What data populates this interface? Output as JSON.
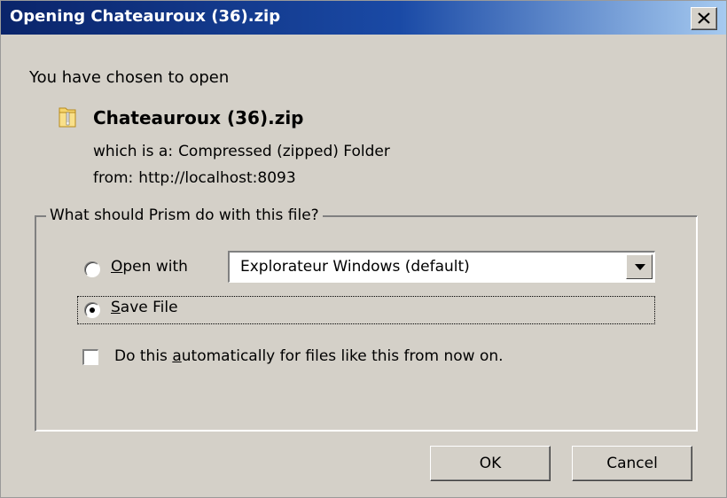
{
  "window": {
    "title": "Opening Chateauroux (36).zip",
    "close_icon": "close-x-icon"
  },
  "info": {
    "intro": "You have chosen to open",
    "file_icon": "zip-folder-icon",
    "file_name": "Chateauroux (36).zip",
    "type_label": "which is a:",
    "type_value": "Compressed (zipped) Folder",
    "from_label": "from:",
    "from_value": "http://localhost:8093"
  },
  "action_group": {
    "legend": "What should Prism do with this file?",
    "open_with": {
      "label_accel": "O",
      "label_rest": "pen with",
      "selected": false,
      "app_value": "Explorateur Windows (default)"
    },
    "save_file": {
      "label_accel": "S",
      "label_rest": "ave File",
      "selected": true
    },
    "auto": {
      "label_before": "Do this ",
      "label_accel": "a",
      "label_after": "utomatically for files like this from now on.",
      "checked": false
    }
  },
  "buttons": {
    "ok": "OK",
    "cancel": "Cancel"
  },
  "colors": {
    "titlebar_start": "#0a246a",
    "titlebar_end": "#a6caf0",
    "dialog_face": "#d4d0c8"
  }
}
